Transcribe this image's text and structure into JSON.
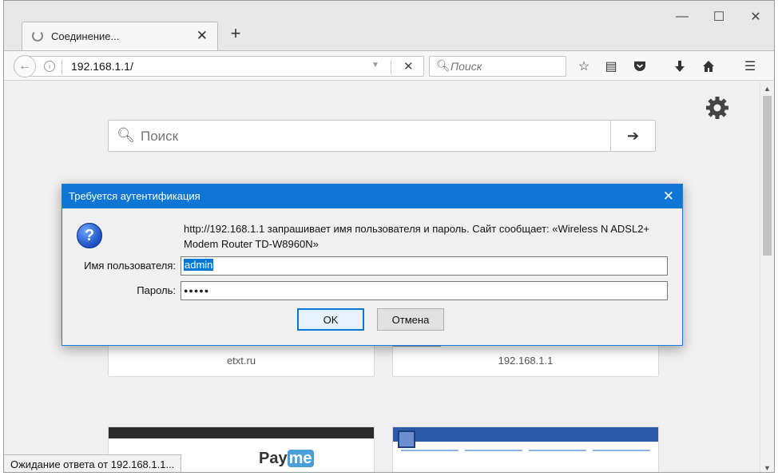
{
  "tab": {
    "title": "Соединение...",
    "close": "✕",
    "new_tab": "+"
  },
  "window_controls": {
    "minimize": "—",
    "maximize": "☐",
    "close": "✕"
  },
  "navbar": {
    "url": "192.168.1.1/",
    "search_placeholder": "Поиск"
  },
  "home": {
    "search_placeholder": "Поиск",
    "tiles": [
      {
        "label": "etxt.ru"
      },
      {
        "label": "192.168.1.1"
      }
    ],
    "preview_payme": "Pay",
    "preview_payme_accent": "me"
  },
  "status": "Ожидание ответа от 192.168.1.1...",
  "dialog": {
    "title": "Требуется аутентификация",
    "close": "✕",
    "message": "http://192.168.1.1 запрашивает имя пользователя и пароль. Сайт сообщает: «Wireless N ADSL2+ Modem Router TD-W8960N»",
    "username_label": "Имя пользователя:",
    "username_value": "admin",
    "password_label": "Пароль:",
    "password_value": "●●●●●",
    "ok_label": "OK",
    "cancel_label": "Отмена"
  },
  "colors": {
    "dialog_title_bg": "#0f76d6",
    "selection": "#0078d7"
  },
  "icons": [
    "back-arrow-icon",
    "info-icon",
    "dropdown-icon",
    "stop-icon",
    "search-icon",
    "bookmark-star-icon",
    "reader-list-icon",
    "pocket-icon",
    "download-icon",
    "home-icon",
    "menu-icon",
    "gear-icon",
    "arrow-right-icon",
    "question-icon"
  ]
}
